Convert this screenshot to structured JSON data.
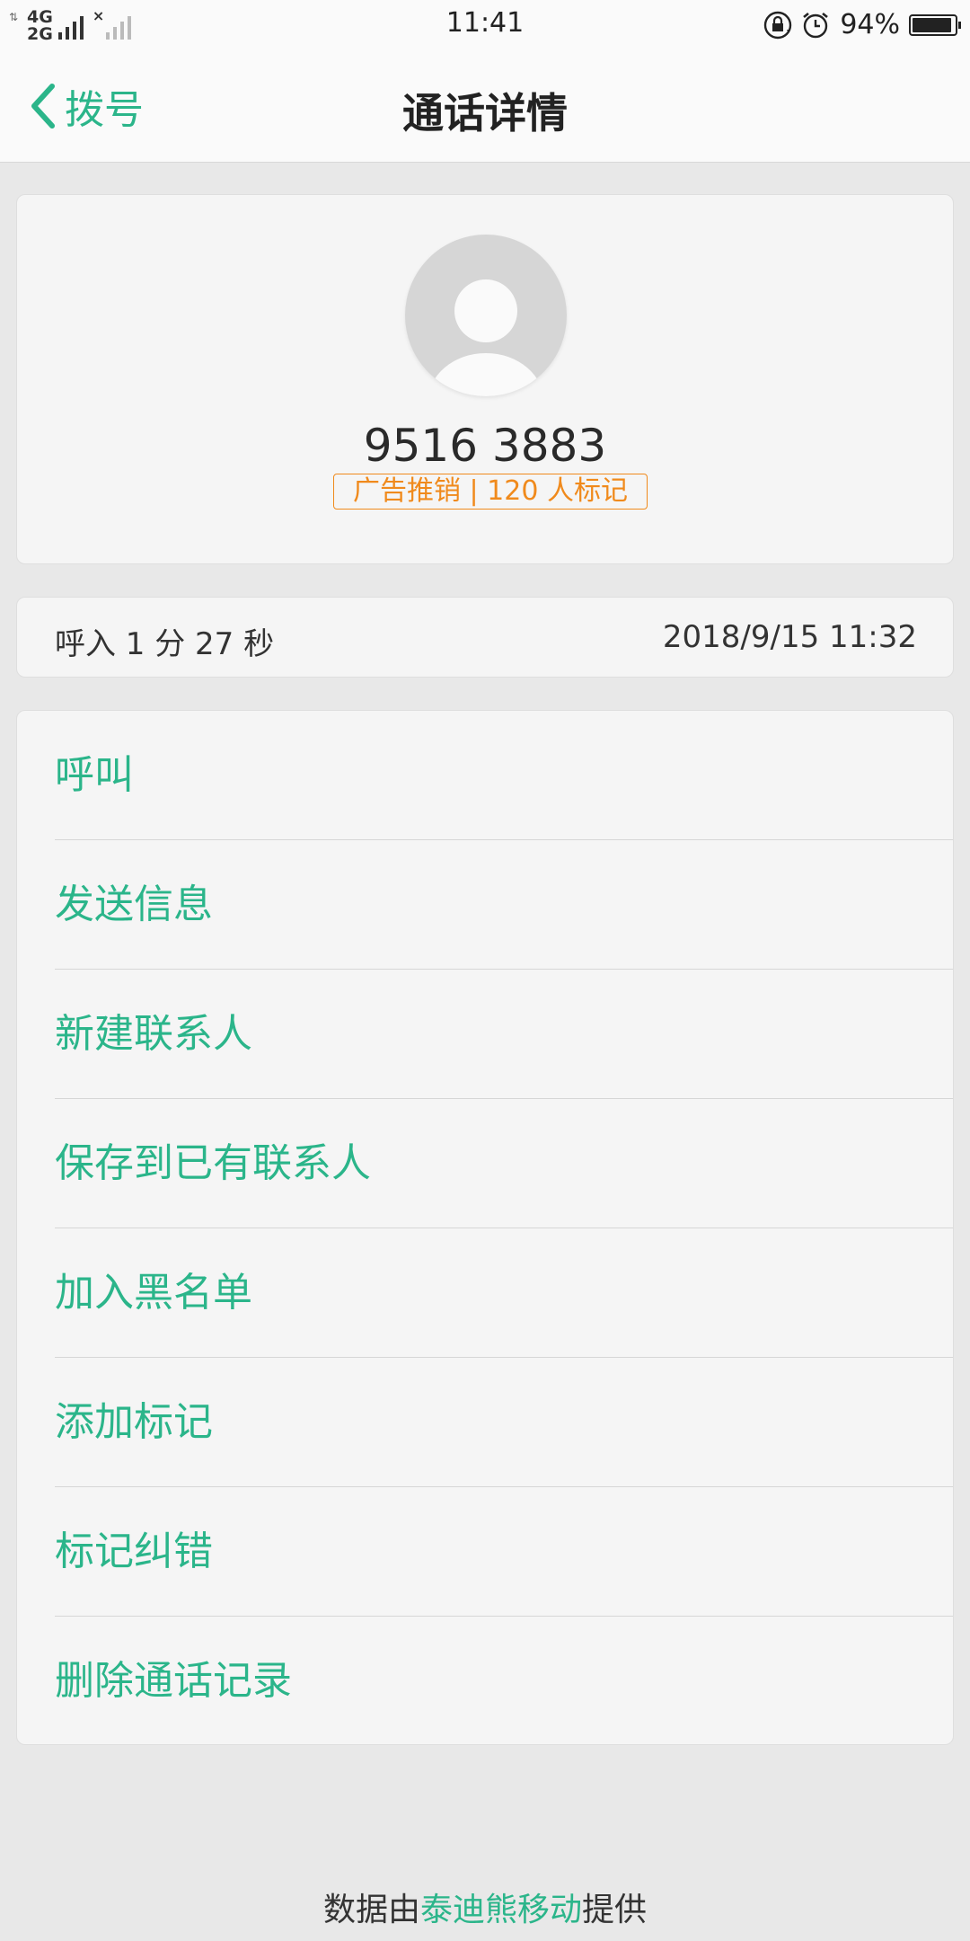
{
  "status_bar": {
    "network_top": "4G",
    "network_bottom": "2G",
    "time": "11:41",
    "battery_percent": "94%",
    "battery_level": 0.94
  },
  "header": {
    "back_label": "拨号",
    "title": "通话详情"
  },
  "contact": {
    "number": "9516 3883",
    "tag": "广告推销 | 120 人标记"
  },
  "call": {
    "info": "呼入  1 分 27 秒",
    "datetime": "2018/9/15 11:32"
  },
  "actions": [
    {
      "label": "呼叫"
    },
    {
      "label": "发送信息"
    },
    {
      "label": "新建联系人"
    },
    {
      "label": "保存到已有联系人"
    },
    {
      "label": "加入黑名单"
    },
    {
      "label": "添加标记"
    },
    {
      "label": "标记纠错"
    },
    {
      "label": "删除通话记录"
    }
  ],
  "footer": {
    "prefix": "数据由",
    "brand": "泰迪熊移动",
    "suffix": "提供"
  },
  "colors": {
    "accent": "#2bb58a",
    "tag": "#f08a1c"
  }
}
